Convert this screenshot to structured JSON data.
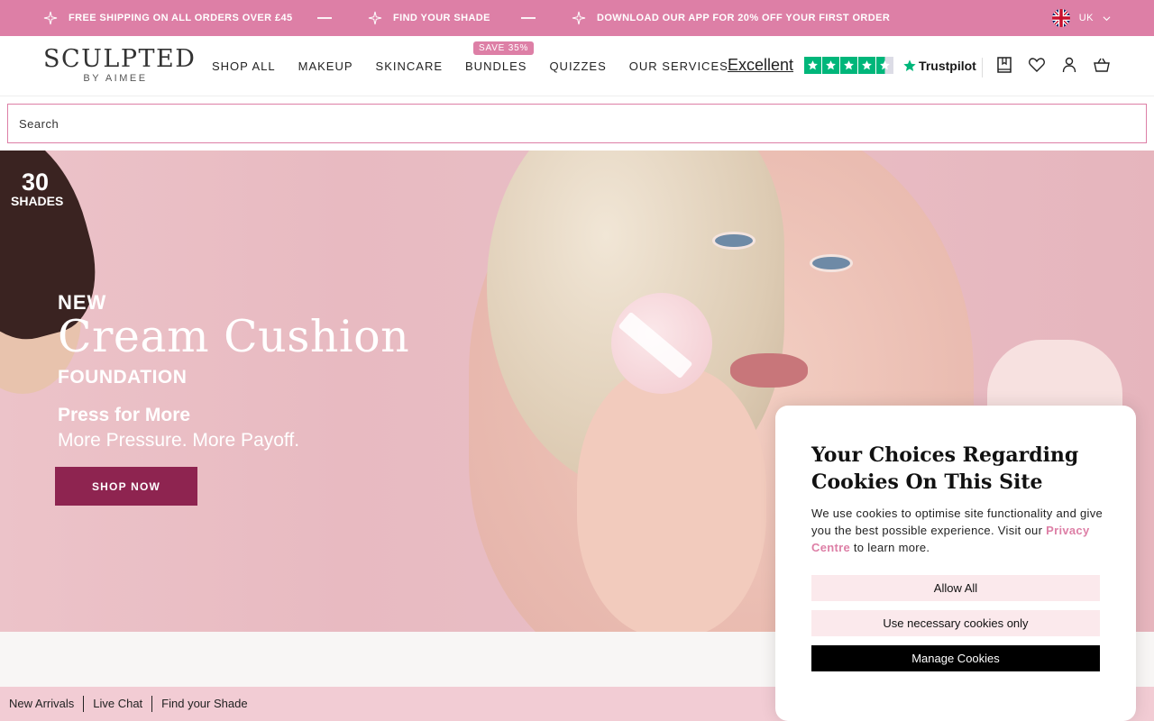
{
  "announcement": {
    "items": [
      "FREE SHIPPING ON ALL ORDERS OVER £45",
      "FIND YOUR SHADE",
      "DOWNLOAD OUR APP FOR 20% OFF YOUR FIRST ORDER"
    ],
    "locale": "UK",
    "bg_color": "#dd7fa6"
  },
  "header": {
    "logo_main": "SCULPTED",
    "logo_sub": "BY AIMEE",
    "nav": [
      "SHOP ALL",
      "MAKEUP",
      "SKINCARE",
      "BUNDLES",
      "QUIZZES",
      "OUR SERVICES"
    ],
    "bundles_badge": "SAVE 35%",
    "trustpilot": {
      "rating_word": "Excellent",
      "stars": 4.5,
      "brand": "Trustpilot"
    },
    "icons": [
      "account-book-icon",
      "wishlist-heart-icon",
      "user-icon",
      "basket-icon"
    ]
  },
  "search": {
    "placeholder": "Search"
  },
  "hero": {
    "shades_number": "30",
    "shades_label": "SHADES",
    "new_label": "NEW",
    "title": "Cream Cushion",
    "subtitle": "FOUNDATION",
    "press_line": "Press for More",
    "more_line": "More Pressure. More Payoff.",
    "cta": "SHOP NOW"
  },
  "bottom_links": [
    "New Arrivals",
    "Live Chat",
    "Find your Shade"
  ],
  "cookie": {
    "title": "Your Choices Regarding Cookies On This Site",
    "body_before": "We use cookies to optimise site functionality and give you the best possible experience. Visit our ",
    "link": "Privacy Centre",
    "body_after": " to learn more.",
    "allow_all": "Allow All",
    "necessary_only": "Use necessary cookies only",
    "manage": "Manage Cookies"
  },
  "colors": {
    "brand_pink": "#dd7fa6",
    "cta_plum": "#8e2450",
    "trustpilot_green": "#00b67a"
  }
}
